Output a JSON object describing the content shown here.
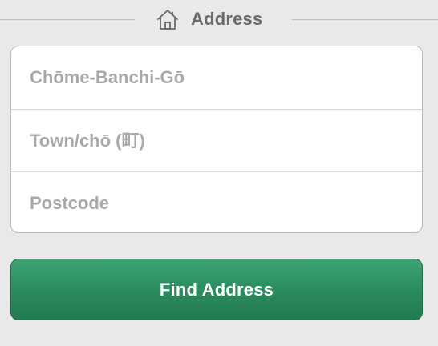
{
  "section": {
    "icon": "house-icon",
    "title": "Address"
  },
  "fields": {
    "chome": {
      "placeholder": "Chōme-Banchi-Gō",
      "value": ""
    },
    "town": {
      "placeholder": "Town/chō (町)",
      "value": ""
    },
    "postcode": {
      "placeholder": "Postcode",
      "value": ""
    }
  },
  "button": {
    "label": "Find Address",
    "color": "#2a8a5c"
  }
}
